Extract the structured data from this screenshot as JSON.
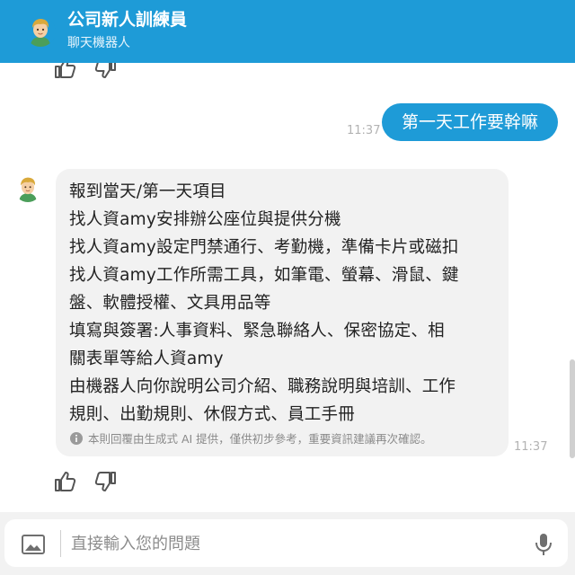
{
  "header": {
    "title": "公司新人訓練員",
    "subtitle": "聊天機器人",
    "avatar_icon": "boy-avatar-icon",
    "background_color": "#1e9bd7"
  },
  "messages": {
    "user": {
      "text": "第一天工作要幹嘛",
      "time": "11:37",
      "bubble_color": "#1e9bd7"
    },
    "bot": {
      "lines": [
        "報到當天/第一天項目",
        "找人資amy安排辦公座位與提供分機",
        "找人資amy設定門禁通行、考勤機，準備卡片或磁扣",
        "找人資amy工作所需工具，如筆電、螢幕、滑鼠、鍵",
        "盤、軟體授權、文具用品等",
        "填寫與簽署:人事資料、緊急聯絡人、保密協定、相",
        "關表單等給人資amy",
        "由機器人向你說明公司介紹、職務說明與培訓、工作",
        "規則、出勤規則、休假方式、員工手冊"
      ],
      "disclaimer": "本則回覆由生成式 AI 提供，僅供初步參考，重要資訊建議再次確認。",
      "time": "11:37",
      "bubble_color": "#f2f2f2"
    }
  },
  "feedback": {
    "like_icon": "thumbs-up-icon",
    "dislike_icon": "thumbs-down-icon"
  },
  "input": {
    "placeholder": "直接輸入您的問題",
    "image_icon": "image-icon",
    "mic_icon": "microphone-icon"
  }
}
